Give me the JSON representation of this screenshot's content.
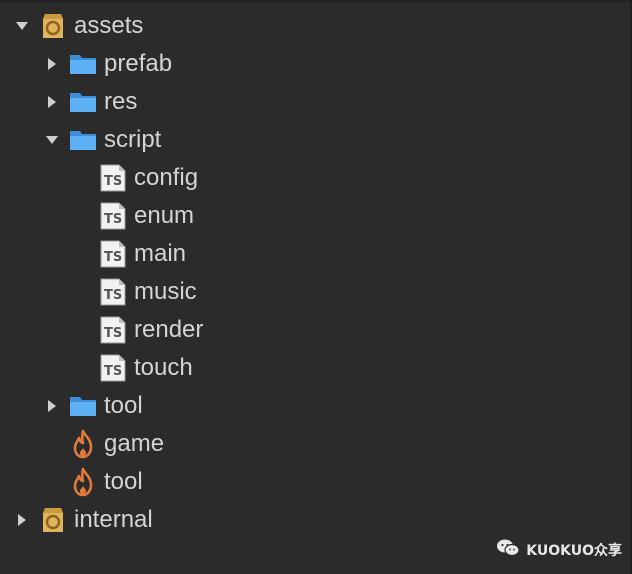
{
  "tree": {
    "root_assets": {
      "label": "assets",
      "icon": "db-icon",
      "expanded": true
    },
    "prefab": {
      "label": "prefab",
      "icon": "folder-icon",
      "expanded": false
    },
    "res": {
      "label": "res",
      "icon": "folder-icon",
      "expanded": false
    },
    "script": {
      "label": "script",
      "icon": "folder-icon",
      "expanded": true,
      "files": [
        {
          "label": "config",
          "icon": "ts-file-icon"
        },
        {
          "label": "enum",
          "icon": "ts-file-icon"
        },
        {
          "label": "main",
          "icon": "ts-file-icon"
        },
        {
          "label": "music",
          "icon": "ts-file-icon"
        },
        {
          "label": "render",
          "icon": "ts-file-icon"
        },
        {
          "label": "touch",
          "icon": "ts-file-icon"
        }
      ]
    },
    "tool_folder": {
      "label": "tool",
      "icon": "folder-icon",
      "expanded": false
    },
    "scene_game": {
      "label": "game",
      "icon": "fire-icon"
    },
    "scene_tool": {
      "label": "tool",
      "icon": "fire-icon"
    },
    "root_internal": {
      "label": "internal",
      "icon": "db-icon",
      "expanded": false
    }
  },
  "watermark": {
    "text": "KUOKUO众享"
  },
  "colors": {
    "background": "#2b2b2b",
    "text": "#d4d4d4",
    "folder": "#4aa3f0",
    "db": "#e0b45a",
    "fire": "#e07a3c"
  }
}
